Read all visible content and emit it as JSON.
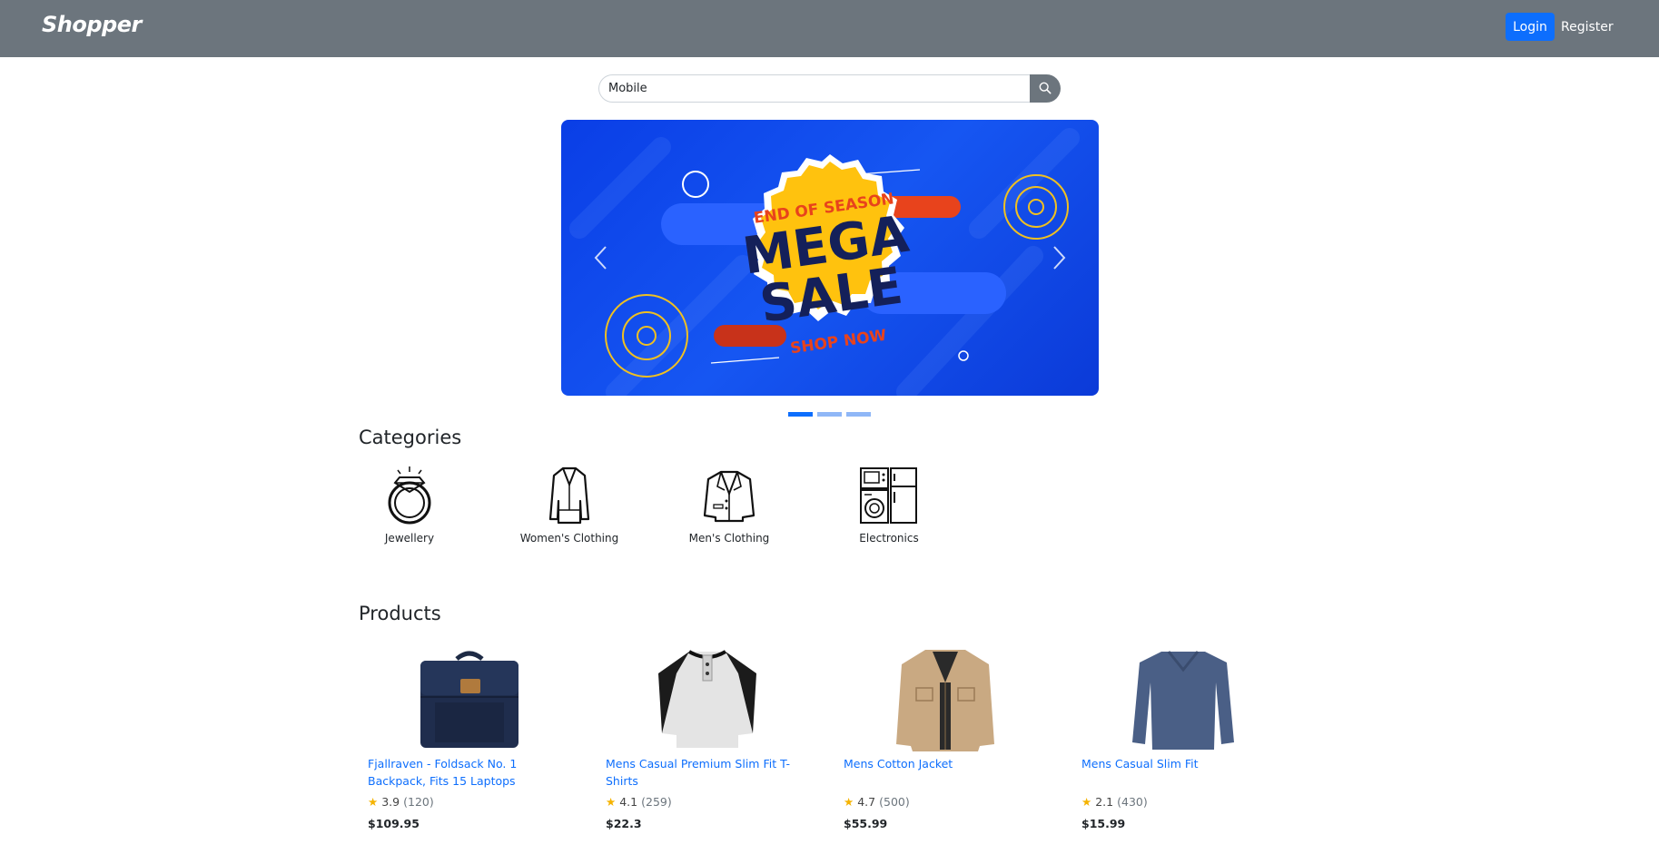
{
  "navbar": {
    "brand": "Shopper",
    "login_label": "Login",
    "register_label": "Register"
  },
  "search": {
    "value": "Mobile",
    "icon": "search-icon"
  },
  "carousel": {
    "slide": {
      "line1": "END OF SEASON",
      "line2": "MEGA",
      "line3": "SALE",
      "line4": "SHOP NOW"
    },
    "prev_icon": "chevron-left-icon",
    "next_icon": "chevron-right-icon",
    "slides_total": 3,
    "active_index": 0
  },
  "categories": {
    "title": "Categories",
    "items": [
      {
        "label": "Jewellery",
        "icon": "ring-icon"
      },
      {
        "label": "Women's Clothing",
        "icon": "coat-icon"
      },
      {
        "label": "Men's Clothing",
        "icon": "blazer-icon"
      },
      {
        "label": "Electronics",
        "icon": "appliances-icon"
      }
    ]
  },
  "products": {
    "title": "Products",
    "items": [
      {
        "title": "Fjallraven - Foldsack No. 1 Backpack, Fits 15 Laptops",
        "rating": "3.9",
        "count": "(120)",
        "price": "$109.95"
      },
      {
        "title": "Mens Casual Premium Slim Fit T-Shirts",
        "rating": "4.1",
        "count": "(259)",
        "price": "$22.3"
      },
      {
        "title": "Mens Cotton Jacket",
        "rating": "4.7",
        "count": "(500)",
        "price": "$55.99"
      },
      {
        "title": "Mens Casual Slim Fit",
        "rating": "2.1",
        "count": "(430)",
        "price": "$15.99"
      }
    ]
  },
  "colors": {
    "navbar": "#6c757d",
    "primary": "#0d6efd",
    "star": "#f5b301"
  }
}
